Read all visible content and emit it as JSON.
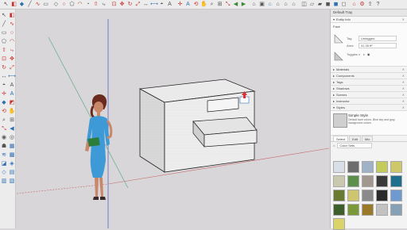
{
  "toolbar": {
    "top_icons": [
      {
        "name": "select-icon",
        "glyph": "↖",
        "tone": ""
      },
      {
        "name": "eraser-icon",
        "glyph": "◧",
        "tone": "r"
      },
      {
        "name": "paint-bucket-icon",
        "glyph": "◆",
        "tone": "b"
      },
      {
        "name": "line-icon",
        "glyph": "╱",
        "tone": ""
      },
      {
        "name": "freehand-icon",
        "glyph": "∿",
        "tone": "r"
      },
      {
        "name": "rectangle-icon",
        "glyph": "▭",
        "tone": ""
      },
      {
        "name": "rotated-rectangle-icon",
        "glyph": "◇",
        "tone": ""
      },
      {
        "name": "circle-icon",
        "glyph": "○",
        "tone": "r"
      },
      {
        "name": "polygon-icon",
        "glyph": "⬠",
        "tone": ""
      },
      {
        "name": "arc-icon",
        "glyph": "◠",
        "tone": "r"
      },
      {
        "name": "pie-icon",
        "glyph": "◔",
        "tone": ""
      },
      {
        "name": "push-pull-icon",
        "glyph": "⇧",
        "tone": "r"
      },
      {
        "name": "follow-me-icon",
        "glyph": "⤷",
        "tone": ""
      },
      {
        "name": "offset-icon",
        "glyph": "⊡",
        "tone": "r"
      },
      {
        "name": "move-icon",
        "glyph": "✥",
        "tone": "r"
      },
      {
        "name": "rotate-icon",
        "glyph": "↻",
        "tone": "r"
      },
      {
        "name": "scale-icon",
        "glyph": "⤢",
        "tone": "r"
      },
      {
        "name": "tape-measure-icon",
        "glyph": "↔",
        "tone": ""
      },
      {
        "name": "dimension-icon",
        "glyph": "⟷",
        "tone": "b"
      },
      {
        "name": "protractor-icon",
        "glyph": "◓",
        "tone": ""
      },
      {
        "name": "text-icon",
        "glyph": "A",
        "tone": ""
      },
      {
        "name": "axes-icon",
        "glyph": "✛",
        "tone": "r"
      },
      {
        "name": "3d-text-icon",
        "glyph": "A",
        "tone": "b"
      },
      {
        "name": "orbit-icon",
        "glyph": "⟲",
        "tone": "r"
      },
      {
        "name": "pan-icon",
        "glyph": "✋",
        "tone": ""
      },
      {
        "name": "zoom-icon",
        "glyph": "⌕",
        "tone": ""
      },
      {
        "name": "zoom-window-icon",
        "glyph": "⊞",
        "tone": ""
      },
      {
        "name": "zoom-extents-icon",
        "glyph": "⤡",
        "tone": "r"
      },
      {
        "name": "previous-view-icon",
        "glyph": "◀",
        "tone": "g"
      },
      {
        "name": "next-view-icon",
        "glyph": "▶",
        "tone": "g"
      },
      {
        "name": "iso-view-icon",
        "glyph": "⌂",
        "tone": ""
      },
      {
        "name": "top-view-icon",
        "glyph": "▣",
        "tone": ""
      },
      {
        "name": "front-view-icon",
        "glyph": "⌂",
        "tone": "b"
      },
      {
        "name": "right-view-icon",
        "glyph": "⌂",
        "tone": ""
      },
      {
        "name": "back-view-icon",
        "glyph": "⌂",
        "tone": ""
      },
      {
        "name": "left-view-icon",
        "glyph": "⌂",
        "tone": ""
      },
      {
        "name": "xray-icon",
        "glyph": "◫",
        "tone": ""
      },
      {
        "name": "wireframe-icon",
        "glyph": "▱",
        "tone": ""
      },
      {
        "name": "hidden-line-icon",
        "glyph": "▰",
        "tone": ""
      },
      {
        "name": "shaded-icon",
        "glyph": "◼",
        "tone": ""
      },
      {
        "name": "textured-icon",
        "glyph": "◼",
        "tone": "b"
      },
      {
        "name": "monochrome-icon",
        "glyph": "◻",
        "tone": ""
      },
      {
        "name": "warehouse-icon",
        "glyph": "⌂",
        "tone": "r"
      },
      {
        "name": "extension-icon",
        "glyph": "⚙",
        "tone": "r"
      },
      {
        "name": "share-icon",
        "glyph": "⇪",
        "tone": ""
      },
      {
        "name": "help-icon",
        "glyph": "?",
        "tone": ""
      }
    ],
    "left_icons": [
      {
        "name": "select-icon",
        "glyph": "↖",
        "tone": ""
      },
      {
        "name": "eraser-icon",
        "glyph": "◧",
        "tone": "r"
      },
      {
        "name": "line-icon",
        "glyph": "╱",
        "tone": ""
      },
      {
        "name": "freehand-icon",
        "glyph": "∿",
        "tone": "r"
      },
      {
        "name": "rectangle-icon",
        "glyph": "▭",
        "tone": ""
      },
      {
        "name": "circle-icon",
        "glyph": "○",
        "tone": "r"
      },
      {
        "name": "polygon-icon",
        "glyph": "⬠",
        "tone": ""
      },
      {
        "name": "arc-icon",
        "glyph": "◠",
        "tone": "r"
      },
      {
        "name": "push-pull-icon",
        "glyph": "⇧",
        "tone": "r"
      },
      {
        "name": "follow-me-icon",
        "glyph": "⤷",
        "tone": "r"
      },
      {
        "name": "offset-icon",
        "glyph": "⊡",
        "tone": "r"
      },
      {
        "name": "move-icon",
        "glyph": "✥",
        "tone": "r"
      },
      {
        "name": "rotate-icon",
        "glyph": "↻",
        "tone": "r"
      },
      {
        "name": "scale-icon",
        "glyph": "⤢",
        "tone": "r"
      },
      {
        "name": "tape-measure-icon",
        "glyph": "↔",
        "tone": ""
      },
      {
        "name": "dimension-icon",
        "glyph": "⟷",
        "tone": "b"
      },
      {
        "name": "protractor-icon",
        "glyph": "◓",
        "tone": ""
      },
      {
        "name": "text-icon",
        "glyph": "A",
        "tone": ""
      },
      {
        "name": "axes-icon",
        "glyph": "✛",
        "tone": "r"
      },
      {
        "name": "3d-text-icon",
        "glyph": "A",
        "tone": "b"
      },
      {
        "name": "paint-bucket-icon",
        "glyph": "◆",
        "tone": "b"
      },
      {
        "name": "section-plane-icon",
        "glyph": "◩",
        "tone": "r"
      },
      {
        "name": "orbit-icon",
        "glyph": "⟲",
        "tone": "r"
      },
      {
        "name": "pan-icon",
        "glyph": "✋",
        "tone": ""
      },
      {
        "name": "zoom-icon",
        "glyph": "⌕",
        "tone": ""
      },
      {
        "name": "zoom-window-icon",
        "glyph": "⊞",
        "tone": ""
      },
      {
        "name": "zoom-extents-icon",
        "glyph": "⤡",
        "tone": "r"
      },
      {
        "name": "previous-view-icon",
        "glyph": "◀",
        "tone": "b"
      },
      {
        "name": "position-camera-icon",
        "glyph": "◉",
        "tone": ""
      },
      {
        "name": "look-around-icon",
        "glyph": "◎",
        "tone": ""
      },
      {
        "name": "walk-icon",
        "glyph": "☗",
        "tone": ""
      },
      {
        "name": "sandbox-icon",
        "glyph": "▦",
        "tone": "b"
      },
      {
        "name": "smoove-icon",
        "glyph": "≋",
        "tone": "b"
      },
      {
        "name": "stamp-icon",
        "glyph": "▩",
        "tone": "b"
      },
      {
        "name": "drape-icon",
        "glyph": "◪",
        "tone": "b"
      },
      {
        "name": "add-detail-icon",
        "glyph": "◈",
        "tone": "b"
      },
      {
        "name": "flip-edge-icon",
        "glyph": "◇",
        "tone": "b"
      },
      {
        "name": "section-fill-icon",
        "glyph": "▤",
        "tone": "b"
      },
      {
        "name": "display-section-icon",
        "glyph": "▥",
        "tone": "b"
      },
      {
        "name": "display-cuts-icon",
        "glyph": "▧",
        "tone": "b"
      }
    ]
  },
  "tray": {
    "title": "Default Tray",
    "entity_info": {
      "header": "Entity Info",
      "entity_type": "Face",
      "tag_label": "Tag",
      "tag_value": "Untagged",
      "area_label": "Area",
      "area_value": "31.35 ft²",
      "toggles_label": "Toggles"
    },
    "panels": [
      "Materials",
      "Components",
      "Tags",
      "Shadows",
      "Scenes",
      "Instructor",
      "Styles"
    ],
    "styles": {
      "style_name": "Simple Style",
      "style_desc": "Default face colors. Blue sky and gray background colors.",
      "tabs": [
        "Select",
        "Edit",
        "Mix"
      ],
      "collection": "Color Sets"
    },
    "swatches": [
      "#d8dfe6",
      "#6d6d6d",
      "#9fb2c8",
      "#c3cc5a",
      "#cfc86a",
      "#c9c9b0",
      "#5b8f4a",
      "#a19890",
      "#3a3a3a",
      "#1f6e8c",
      "#6a7a32",
      "#cfc56e",
      "#8a8a8a",
      "#2a2a2a",
      "#6f9ad0",
      "#3e5f2c",
      "#7a9a3a",
      "#9a7a2a",
      "#c2c2c2",
      "#86a0b6",
      "#d9d36a"
    ]
  }
}
